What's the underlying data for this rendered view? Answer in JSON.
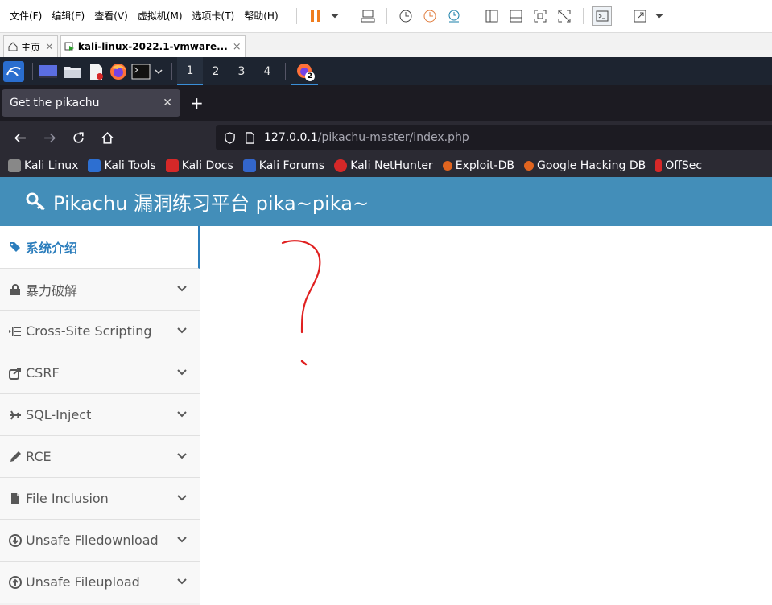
{
  "vm_menubar": {
    "menus": [
      "文件(F)",
      "编辑(E)",
      "查看(V)",
      "虚拟机(M)",
      "选项卡(T)",
      "帮助(H)"
    ]
  },
  "vm_tabs": [
    {
      "label": "主页"
    },
    {
      "label": "kali-linux-2022.1-vmware..."
    }
  ],
  "kali_panel": {
    "workspaces": [
      "1",
      "2",
      "3",
      "4"
    ],
    "active_workspace": "1",
    "badge": "2"
  },
  "browser": {
    "tab_title": "Get the pikachu",
    "url_host": "127.0.0.1",
    "url_path": "/pikachu-master/index.php",
    "bookmarks": [
      {
        "label": "Kali Linux",
        "color": "#888888"
      },
      {
        "label": "Kali Tools",
        "color": "#2d6fd1"
      },
      {
        "label": "Kali Docs",
        "color": "#d62828"
      },
      {
        "label": "Kali Forums",
        "color": "#3366cc"
      },
      {
        "label": "Kali NetHunter",
        "color": "#d62828"
      },
      {
        "label": "Exploit-DB",
        "color": "#e0641f"
      },
      {
        "label": "Google Hacking DB",
        "color": "#e0641f"
      },
      {
        "label": "OffSec",
        "color": "#d62828"
      }
    ]
  },
  "app": {
    "title": "Pikachu 漏洞练习平台 pika~pika~",
    "header_color": "#438eb9",
    "sidebar": [
      {
        "label": "系统介绍",
        "icon": "tags-icon",
        "active": true
      },
      {
        "label": "暴力破解",
        "icon": "lock-icon"
      },
      {
        "label": "Cross-Site Scripting",
        "icon": "list-indent-icon"
      },
      {
        "label": "CSRF",
        "icon": "share-icon"
      },
      {
        "label": "SQL-Inject",
        "icon": "plane-icon"
      },
      {
        "label": "RCE",
        "icon": "pencil-icon"
      },
      {
        "label": "File Inclusion",
        "icon": "file-icon"
      },
      {
        "label": "Unsafe Filedownload",
        "icon": "download-icon"
      },
      {
        "label": "Unsafe Fileupload",
        "icon": "upload-icon"
      }
    ]
  }
}
